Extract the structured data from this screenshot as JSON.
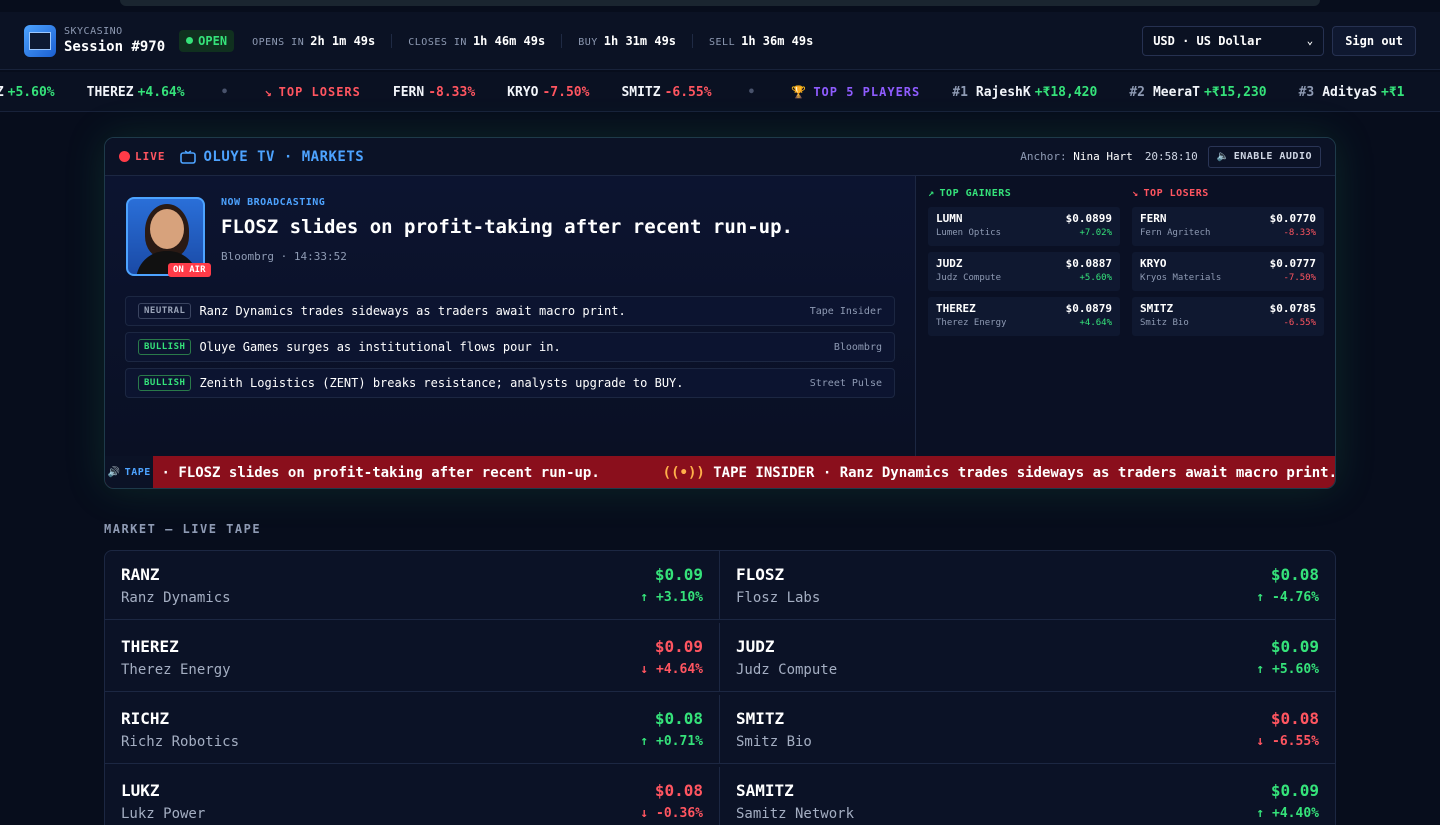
{
  "header": {
    "brand": "SKYCASINO",
    "session": "Session #970",
    "status": "OPEN",
    "timers": [
      {
        "label": "OPENS IN",
        "value": "2h 1m 49s"
      },
      {
        "label": "CLOSES IN",
        "value": "1h 46m 49s"
      },
      {
        "label": "BUY",
        "value": "1h 31m 49s"
      },
      {
        "label": "SELL",
        "value": "1h 36m 49s"
      }
    ],
    "currency": "USD · US Dollar",
    "signout": "Sign out"
  },
  "ticker": {
    "gainers": [
      {
        "sym": "DZ",
        "chg": "+5.60%"
      },
      {
        "sym": "THEREZ",
        "chg": "+4.64%"
      }
    ],
    "losers_label": "TOP LOSERS",
    "losers": [
      {
        "sym": "FERN",
        "chg": "-8.33%"
      },
      {
        "sym": "KRYO",
        "chg": "-7.50%"
      },
      {
        "sym": "SMITZ",
        "chg": "-6.55%"
      }
    ],
    "players_label": "TOP 5 PLAYERS",
    "players": [
      {
        "rank": "#1",
        "name": "RajeshK",
        "amount": "+₹18,420"
      },
      {
        "rank": "#2",
        "name": "MeeraT",
        "amount": "+₹15,230"
      },
      {
        "rank": "#3",
        "name": "AdityaS",
        "amount": "+₹1"
      }
    ]
  },
  "tv": {
    "live": "LIVE",
    "title": "OLUYE TV · MARKETS",
    "anchor_label": "Anchor:",
    "anchor_name": "Nina Hart",
    "clock": "20:58:10",
    "audio": "ENABLE AUDIO",
    "on_air": "ON AIR",
    "now_label": "NOW BROADCASTING",
    "headline": "FLOSZ slides on profit-taking after recent run-up.",
    "headline_meta": "Bloombrg · 14:33:52",
    "news": [
      {
        "sentiment": "NEUTRAL",
        "text": "Ranz Dynamics trades sideways as traders await macro print.",
        "source": "Tape Insider"
      },
      {
        "sentiment": "BULLISH",
        "text": "Oluye Games surges as institutional flows pour in.",
        "source": "Bloombrg"
      },
      {
        "sentiment": "BULLISH",
        "text": "Zenith Logistics (ZENT) breaks resistance; analysts upgrade to BUY.",
        "source": "Street Pulse"
      }
    ],
    "gainers_label": "TOP GAINERS",
    "gainers": [
      {
        "sym": "LUMN",
        "name": "Lumen Optics",
        "price": "$0.0899",
        "chg": "+7.02%"
      },
      {
        "sym": "JUDZ",
        "name": "Judz Compute",
        "price": "$0.0887",
        "chg": "+5.60%"
      },
      {
        "sym": "THEREZ",
        "name": "Therez Energy",
        "price": "$0.0879",
        "chg": "+4.64%"
      }
    ],
    "losers_label": "TOP LOSERS",
    "losers": [
      {
        "sym": "FERN",
        "name": "Fern Agritech",
        "price": "$0.0770",
        "chg": "-8.33%"
      },
      {
        "sym": "KRYO",
        "name": "Kryos Materials",
        "price": "$0.0777",
        "chg": "-7.50%"
      },
      {
        "sym": "SMITZ",
        "name": "Smitz Bio",
        "price": "$0.0785",
        "chg": "-6.55%"
      }
    ],
    "tape_label": "TAPE",
    "tape_text1": "· FLOSZ slides on profit-taking after recent run-up.",
    "tape_tag": "TAPE INSIDER",
    "tape_text2": "· Ranz Dynamics trades sideways as traders await macro print."
  },
  "market": {
    "title": "MARKET — LIVE TAPE",
    "rows": [
      {
        "sym": "RANZ",
        "name": "Ranz Dynamics",
        "price": "$0.09",
        "chg": "+3.10%",
        "price_up": true,
        "chg_up": true
      },
      {
        "sym": "FLOSZ",
        "name": "Flosz Labs",
        "price": "$0.08",
        "chg": "-4.76%",
        "price_up": true,
        "chg_up": true
      },
      {
        "sym": "THEREZ",
        "name": "Therez Energy",
        "price": "$0.09",
        "chg": "+4.64%",
        "price_up": false,
        "chg_up": false
      },
      {
        "sym": "JUDZ",
        "name": "Judz Compute",
        "price": "$0.09",
        "chg": "+5.60%",
        "price_up": true,
        "chg_up": true
      },
      {
        "sym": "RICHZ",
        "name": "Richz Robotics",
        "price": "$0.08",
        "chg": "+0.71%",
        "price_up": true,
        "chg_up": true
      },
      {
        "sym": "SMITZ",
        "name": "Smitz Bio",
        "price": "$0.08",
        "chg": "-6.55%",
        "price_up": false,
        "chg_up": false
      },
      {
        "sym": "LUKZ",
        "name": "Lukz Power",
        "price": "$0.08",
        "chg": "-0.36%",
        "price_up": false,
        "chg_up": false
      },
      {
        "sym": "SAMITZ",
        "name": "Samitz Network",
        "price": "$0.09",
        "chg": "+4.40%",
        "price_up": true,
        "chg_up": true
      }
    ]
  }
}
